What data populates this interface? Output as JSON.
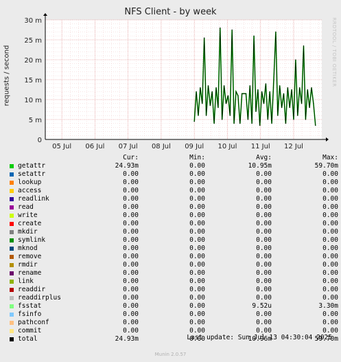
{
  "title": "NFS Client - by week",
  "watermark": "RRDTOOL / TOBI OETIKER",
  "chart_data": {
    "type": "line",
    "title": "NFS Client - by week",
    "ylabel": "requests / second",
    "ylim": [
      0,
      30
    ],
    "yticks": [
      "0",
      "5 m",
      "10 m",
      "15 m",
      "20 m",
      "25 m",
      "30 m"
    ],
    "yvalues": [
      0,
      5,
      10,
      15,
      20,
      25,
      30
    ],
    "xticks": [
      "05 Jul",
      "06 Jul",
      "07 Jul",
      "08 Jul",
      "09 Jul",
      "10 Jul",
      "11 Jul",
      "12 Jul"
    ],
    "grid": true,
    "series": [
      {
        "name": "getattr",
        "color": "#00cc00",
        "unit": "m",
        "x": [
          4.0,
          4.06,
          4.12,
          4.18,
          4.24,
          4.3,
          4.36,
          4.42,
          4.48,
          4.54,
          4.6,
          4.66,
          4.72,
          4.78,
          4.84,
          4.9,
          4.96,
          5.02,
          5.08,
          5.14,
          5.2,
          5.26,
          5.32,
          5.38,
          5.44,
          5.5,
          5.56,
          5.62,
          5.68,
          5.74,
          5.8,
          5.86,
          5.92,
          5.98,
          6.04,
          6.1,
          6.16,
          6.22,
          6.28,
          6.34,
          6.4,
          6.46,
          6.52,
          6.58,
          6.64,
          6.7,
          6.76,
          6.82,
          6.88,
          6.94,
          7.0,
          7.06,
          7.12,
          7.18,
          7.24,
          7.3,
          7.36,
          7.42,
          7.48,
          7.54,
          7.6,
          7.66
        ],
        "values": [
          4.5,
          12.0,
          6.0,
          13.0,
          9.0,
          25.5,
          6.0,
          13.5,
          8.5,
          12.0,
          4.0,
          13.0,
          8.0,
          28.0,
          5.0,
          13.5,
          9.0,
          11.0,
          6.0,
          27.5,
          4.0,
          12.0,
          11.0,
          4.0,
          11.5,
          11.5,
          11.5,
          5.0,
          13.5,
          4.0,
          26.0,
          7.0,
          12.5,
          3.5,
          12.0,
          9.0,
          14.0,
          5.0,
          12.0,
          4.0,
          15.0,
          27.0,
          6.0,
          13.5,
          8.0,
          11.5,
          4.0,
          13.0,
          8.0,
          12.5,
          5.0,
          20.0,
          6.0,
          13.0,
          9.0,
          23.5,
          5.0,
          12.5,
          8.0,
          13.0,
          9.0,
          3.5
        ]
      }
    ]
  },
  "legend": {
    "headers": [
      "Cur:",
      "Min:",
      "Avg:",
      "Max:"
    ],
    "rows": [
      {
        "name": "getattr",
        "color": "#00cc00",
        "cur": "24.93m",
        "min": "0.00",
        "avg": "10.95m",
        "max": "59.70m"
      },
      {
        "name": "setattr",
        "color": "#0066b3",
        "cur": "0.00",
        "min": "0.00",
        "avg": "0.00",
        "max": "0.00"
      },
      {
        "name": "lookup",
        "color": "#ff8000",
        "cur": "0.00",
        "min": "0.00",
        "avg": "0.00",
        "max": "0.00"
      },
      {
        "name": "access",
        "color": "#ffcc00",
        "cur": "0.00",
        "min": "0.00",
        "avg": "0.00",
        "max": "0.00"
      },
      {
        "name": "readlink",
        "color": "#330099",
        "cur": "0.00",
        "min": "0.00",
        "avg": "0.00",
        "max": "0.00"
      },
      {
        "name": "read",
        "color": "#990099",
        "cur": "0.00",
        "min": "0.00",
        "avg": "0.00",
        "max": "0.00"
      },
      {
        "name": "write",
        "color": "#ccff00",
        "cur": "0.00",
        "min": "0.00",
        "avg": "0.00",
        "max": "0.00"
      },
      {
        "name": "create",
        "color": "#ff0000",
        "cur": "0.00",
        "min": "0.00",
        "avg": "0.00",
        "max": "0.00"
      },
      {
        "name": "mkdir",
        "color": "#808080",
        "cur": "0.00",
        "min": "0.00",
        "avg": "0.00",
        "max": "0.00"
      },
      {
        "name": "symlink",
        "color": "#008f00",
        "cur": "0.00",
        "min": "0.00",
        "avg": "0.00",
        "max": "0.00"
      },
      {
        "name": "mknod",
        "color": "#00487d",
        "cur": "0.00",
        "min": "0.00",
        "avg": "0.00",
        "max": "0.00"
      },
      {
        "name": "remove",
        "color": "#b35a00",
        "cur": "0.00",
        "min": "0.00",
        "avg": "0.00",
        "max": "0.00"
      },
      {
        "name": "rmdir",
        "color": "#b38f00",
        "cur": "0.00",
        "min": "0.00",
        "avg": "0.00",
        "max": "0.00"
      },
      {
        "name": "rename",
        "color": "#6b006b",
        "cur": "0.00",
        "min": "0.00",
        "avg": "0.00",
        "max": "0.00"
      },
      {
        "name": "link",
        "color": "#8fb300",
        "cur": "0.00",
        "min": "0.00",
        "avg": "0.00",
        "max": "0.00"
      },
      {
        "name": "readdir",
        "color": "#b30000",
        "cur": "0.00",
        "min": "0.00",
        "avg": "0.00",
        "max": "0.00"
      },
      {
        "name": "readdirplus",
        "color": "#bebebe",
        "cur": "0.00",
        "min": "0.00",
        "avg": "0.00",
        "max": "0.00"
      },
      {
        "name": "fsstat",
        "color": "#80ff80",
        "cur": "0.00",
        "min": "0.00",
        "avg": "9.52u",
        "max": "3.30m"
      },
      {
        "name": "fsinfo",
        "color": "#80c9ff",
        "cur": "0.00",
        "min": "0.00",
        "avg": "0.00",
        "max": "0.00"
      },
      {
        "name": "pathconf",
        "color": "#ffc080",
        "cur": "0.00",
        "min": "0.00",
        "avg": "0.00",
        "max": "0.00"
      },
      {
        "name": "commit",
        "color": "#ffe680",
        "cur": "0.00",
        "min": "0.00",
        "avg": "0.00",
        "max": "0.00"
      },
      {
        "name": "total",
        "color": "#000000",
        "cur": "24.93m",
        "min": "0.00",
        "avg": "10.96m",
        "max": "59.70m"
      }
    ]
  },
  "last_update": "Last update: Sun Jul 13 04:30:04 2025",
  "version": "Munin 2.0.57"
}
